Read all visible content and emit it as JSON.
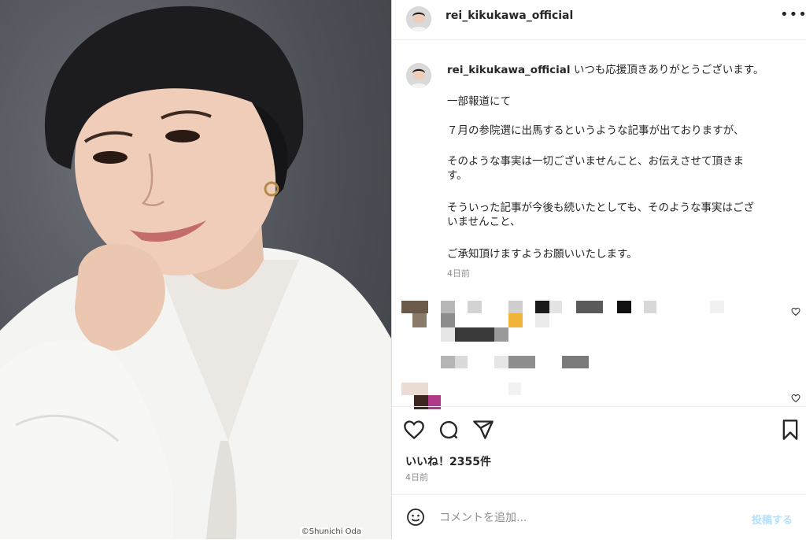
{
  "photo": {
    "credit": "©Shunichi Oda"
  },
  "header": {
    "username": "rei_kikukawa_official",
    "more_icon": "more-horizontal-icon"
  },
  "caption": {
    "username": "rei_kikukawa_official",
    "first_line": "いつも応援頂きありがとうございます。",
    "lines": [
      "一部報道にて",
      "７月の参院選に出馬するというような記事が出ておりますが、",
      "そのような事実は一切ございませんこと、お伝えさせて頂きます。",
      "そういった記事が今後も続いたとしても、そのような事実はございませんこと、",
      "ご承知頂けますようお願いいたします。"
    ],
    "time": "4日前"
  },
  "actions": {
    "like_icon": "heart-icon",
    "comment_icon": "comment-icon",
    "share_icon": "send-icon",
    "save_icon": "bookmark-icon"
  },
  "likes": "いいね！2355件",
  "date": "4日前",
  "comment_bar": {
    "emoji_icon": "emoji-icon",
    "placeholder": "コメントを追加...",
    "post_label": "投稿する"
  },
  "colors": {
    "text": "#262626",
    "muted": "#8e8e8e",
    "post_button": "#b2dffc",
    "divider": "#efefef"
  }
}
